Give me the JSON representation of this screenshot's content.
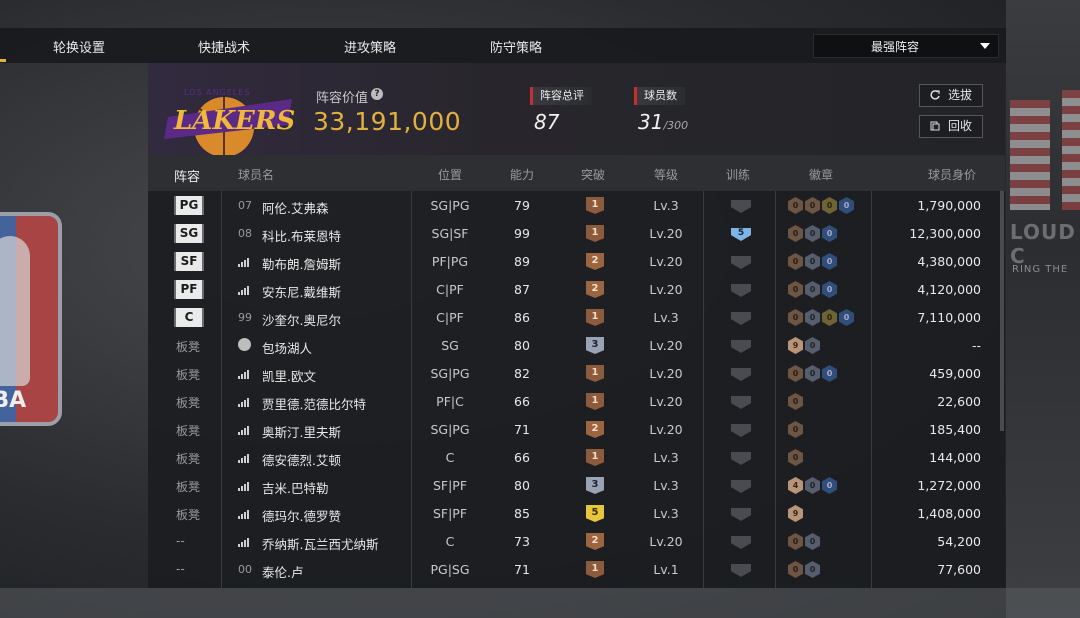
{
  "nav": {
    "items": [
      "轮换设置",
      "快捷战术",
      "进攻策略",
      "防守策略"
    ],
    "lineup_select": "最强阵容"
  },
  "header": {
    "team_logo": "LOS ANGELES LAKERS",
    "value_label": "阵容价值",
    "value": "33,191,000",
    "rating_label": "阵容总评",
    "rating": "87",
    "players_label": "球员数",
    "players_count": "31",
    "players_max": "/300",
    "pick_button": "选拔",
    "recycle_button": "回收"
  },
  "background": {
    "crowd_text_1": "LOUD C",
    "crowd_text_2": "RING THE"
  },
  "nba_logo_text": "NBA",
  "table": {
    "headers": [
      "阵容",
      "球员名",
      "位置",
      "能力",
      "突破",
      "等级",
      "训练",
      "徽章",
      "球员身价"
    ],
    "rows": [
      {
        "slot": "PG",
        "slot_type": "badge",
        "num": "07",
        "name": "阿伦.艾弗森",
        "pos": "SG|PG",
        "ovr": "79",
        "tier": "1",
        "tier_color": "c1",
        "level": "Lv.3",
        "train": "",
        "badges": [
          "br",
          "br",
          "go",
          "bl"
        ],
        "badge_labels": [
          "0",
          "0",
          "0",
          "0"
        ],
        "value": "1,790,000"
      },
      {
        "slot": "SG",
        "slot_type": "badge",
        "num": "08",
        "name": "科比.布莱恩特",
        "pos": "SG|SF",
        "ovr": "99",
        "tier": "1",
        "tier_color": "c1",
        "level": "Lv.20",
        "train": "5",
        "badges": [
          "br",
          "si",
          "bl"
        ],
        "badge_labels": [
          "0",
          "0",
          "0"
        ],
        "value": "12,300,000"
      },
      {
        "slot": "SF",
        "slot_type": "badge",
        "num": "",
        "name": "勒布朗.詹姆斯",
        "pos": "PF|PG",
        "ovr": "89",
        "tier": "2",
        "tier_color": "c2",
        "level": "Lv.20",
        "train": "",
        "badges": [
          "br",
          "si",
          "bl"
        ],
        "badge_labels": [
          "0",
          "0",
          "0"
        ],
        "value": "4,380,000"
      },
      {
        "slot": "PF",
        "slot_type": "badge",
        "num": "",
        "name": "安东尼.戴维斯",
        "pos": "C|PF",
        "ovr": "87",
        "tier": "2",
        "tier_color": "c2",
        "level": "Lv.20",
        "train": "",
        "badges": [
          "br",
          "si",
          "bl"
        ],
        "badge_labels": [
          "0",
          "0",
          "0"
        ],
        "value": "4,120,000"
      },
      {
        "slot": "C",
        "slot_type": "badge",
        "num": "99",
        "name": "沙奎尔.奥尼尔",
        "pos": "C|PF",
        "ovr": "86",
        "tier": "1",
        "tier_color": "c1",
        "level": "Lv.3",
        "train": "",
        "badges": [
          "br",
          "si",
          "go",
          "bl"
        ],
        "badge_labels": [
          "0",
          "0",
          "0",
          "0"
        ],
        "value": "7,110,000"
      },
      {
        "slot": "板凳",
        "slot_type": "bench",
        "num": "",
        "icon": "person",
        "name": "包场湖人",
        "pos": "SG",
        "ovr": "80",
        "tier": "3",
        "tier_color": "c3",
        "level": "Lv.20",
        "train": "",
        "badges": [
          "lit",
          "si"
        ],
        "badge_labels": [
          "9",
          "0"
        ],
        "value": "--"
      },
      {
        "slot": "板凳",
        "slot_type": "bench",
        "num": "",
        "name": "凯里.欧文",
        "pos": "SG|PG",
        "ovr": "82",
        "tier": "1",
        "tier_color": "c1",
        "level": "Lv.20",
        "train": "",
        "badges": [
          "br",
          "si",
          "bl"
        ],
        "badge_labels": [
          "0",
          "0",
          "0"
        ],
        "value": "459,000"
      },
      {
        "slot": "板凳",
        "slot_type": "bench",
        "num": "",
        "name": "贾里德.范德比尔特",
        "pos": "PF|C",
        "ovr": "66",
        "tier": "1",
        "tier_color": "c1",
        "level": "Lv.20",
        "train": "",
        "badges": [
          "br"
        ],
        "badge_labels": [
          "0"
        ],
        "value": "22,600"
      },
      {
        "slot": "板凳",
        "slot_type": "bench",
        "num": "",
        "name": "奥斯汀.里夫斯",
        "pos": "SG|PG",
        "ovr": "71",
        "tier": "2",
        "tier_color": "c2",
        "level": "Lv.20",
        "train": "",
        "badges": [
          "br"
        ],
        "badge_labels": [
          "0"
        ],
        "value": "185,400"
      },
      {
        "slot": "板凳",
        "slot_type": "bench",
        "num": "",
        "name": "德安德烈.艾顿",
        "pos": "C",
        "ovr": "66",
        "tier": "1",
        "tier_color": "c1",
        "level": "Lv.3",
        "train": "",
        "badges": [
          "br"
        ],
        "badge_labels": [
          "0"
        ],
        "value": "144,000"
      },
      {
        "slot": "板凳",
        "slot_type": "bench",
        "num": "",
        "name": "吉米.巴特勒",
        "pos": "SF|PF",
        "ovr": "80",
        "tier": "3",
        "tier_color": "c3",
        "level": "Lv.3",
        "train": "",
        "badges": [
          "lit",
          "si",
          "bl"
        ],
        "badge_labels": [
          "4",
          "0",
          "0"
        ],
        "value": "1,272,000"
      },
      {
        "slot": "板凳",
        "slot_type": "bench",
        "num": "",
        "name": "德玛尔.德罗赞",
        "pos": "SF|PF",
        "ovr": "85",
        "tier": "5",
        "tier_color": "c5",
        "level": "Lv.3",
        "train": "",
        "badges": [
          "lit"
        ],
        "badge_labels": [
          "9"
        ],
        "value": "1,408,000"
      },
      {
        "slot": "--",
        "slot_type": "bench",
        "num": "",
        "name": "乔纳斯.瓦兰西尤纳斯",
        "pos": "C",
        "ovr": "73",
        "tier": "2",
        "tier_color": "c2",
        "level": "Lv.20",
        "train": "",
        "badges": [
          "br",
          "si"
        ],
        "badge_labels": [
          "0",
          "0"
        ],
        "value": "54,200"
      },
      {
        "slot": "--",
        "slot_type": "bench",
        "num": "00",
        "name": "泰伦.卢",
        "pos": "PG|SG",
        "ovr": "71",
        "tier": "1",
        "tier_color": "c1",
        "level": "Lv.1",
        "train": "",
        "badges": [
          "br",
          "si"
        ],
        "badge_labels": [
          "0",
          "0"
        ],
        "value": "77,600"
      }
    ]
  }
}
